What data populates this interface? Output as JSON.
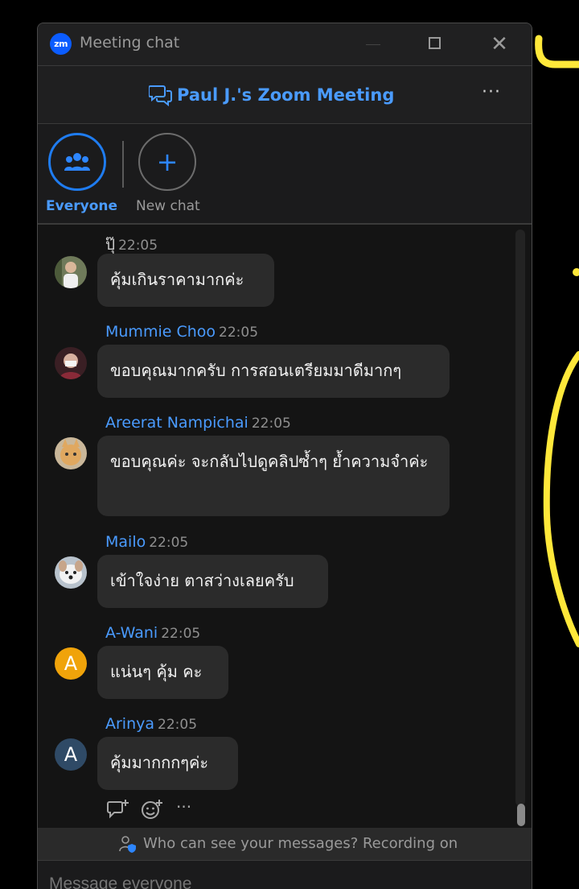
{
  "window": {
    "title": "Meeting chat",
    "logo_text": "zm",
    "close_glyph": "✕"
  },
  "header": {
    "meeting_title": "Paul J.'s Zoom Meeting",
    "more_glyph": "···"
  },
  "tabs": {
    "everyone_label": "Everyone",
    "new_chat_label": "New chat",
    "new_chat_glyph": "+"
  },
  "messages": [
    {
      "sender": "ปุ๊",
      "time": "22:05",
      "text": "คุ้มเกินราคามากค่ะ",
      "avatar": "photo"
    },
    {
      "sender": "Mummie Choo",
      "time": "22:05",
      "text": "ขอบคุณมากครับ การสอนเตรียมมาดีมากๆ",
      "avatar": "photo"
    },
    {
      "sender": "Areerat Nampichai",
      "time": "22:05",
      "text": "ขอบคุณค่ะ จะกลับไปดูคลิปซ้ำๆ ย้ำความจำค่ะ",
      "avatar": "photo"
    },
    {
      "sender": "Mailo",
      "time": "22:05",
      "text": "เข้าใจง่าย ตาสว่างเลยครับ",
      "avatar": "photo"
    },
    {
      "sender": "A-Wani",
      "time": "22:05",
      "text": "แน่นๆ คุ้ม คะ",
      "avatar": "letter",
      "letter": "A",
      "avatar_color": "#f0a30a"
    },
    {
      "sender": "Arinya",
      "time": "22:05",
      "text": "คุ้มมากกกๆค่ะ",
      "avatar": "letter",
      "letter": "A",
      "avatar_color": "#2f4a66"
    }
  ],
  "actions": {
    "more_glyph": "···"
  },
  "footer": {
    "notice": "Who can see your messages? Recording on",
    "input_placeholder": "Message everyone"
  },
  "colors": {
    "accent": "#4a9bff",
    "background": "#141414",
    "bubble": "#2b2b2b",
    "annotation": "#ffe83a"
  }
}
